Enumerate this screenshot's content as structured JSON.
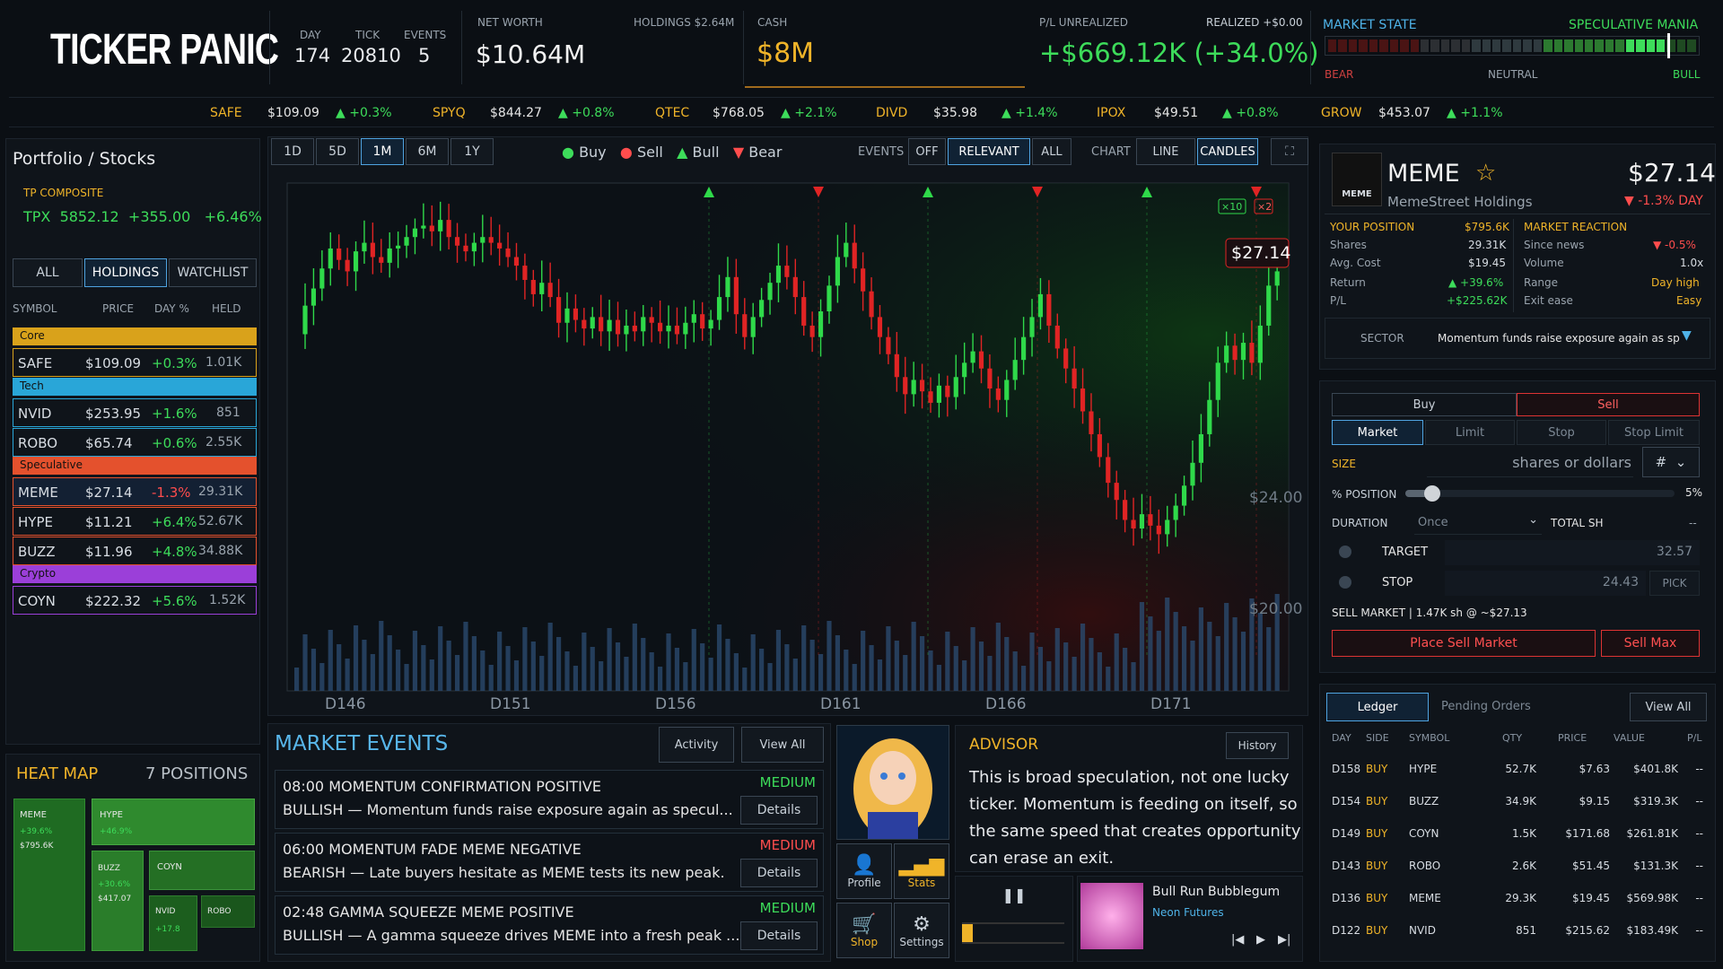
{
  "logo": "TICKER PANIC",
  "header": {
    "day_label": "DAY",
    "day": "174",
    "tick_label": "TICK",
    "tick": "20810",
    "events_label": "EVENTS",
    "events": "5",
    "networth_label": "NET WORTH",
    "networth": "$10.64M",
    "holdings_label": "HOLDINGS $2.64M",
    "cash_label": "CASH",
    "cash": "$8M",
    "pl_label": "P/L UNREALIZED",
    "pl": "+$669.12K (+34.0%)",
    "realized_label": "REALIZED +$0.00",
    "market_state_label": "MARKET STATE",
    "market_state": "SPECULATIVE MANIA",
    "bear": "BEAR",
    "neutral": "NEUTRAL",
    "bull": "BULL",
    "market_level": 0.93
  },
  "ticker_strip": [
    {
      "sym": "SAFE",
      "price": "$109.09",
      "chg": "▲ +0.3%"
    },
    {
      "sym": "SPYQ",
      "price": "$844.27",
      "chg": "▲ +0.8%"
    },
    {
      "sym": "QTEC",
      "price": "$768.05",
      "chg": "▲ +2.1%"
    },
    {
      "sym": "DIVD",
      "price": "$35.98",
      "chg": "▲ +1.4%"
    },
    {
      "sym": "IPOX",
      "price": "$49.51",
      "chg": "▲ +0.8%"
    },
    {
      "sym": "GROW",
      "price": "$453.07",
      "chg": "▲ +1.1%"
    }
  ],
  "portfolio": {
    "title": "Portfolio / Stocks",
    "index_label": "TP COMPOSITE",
    "index_sym": "TPX",
    "index_val": "5852.12",
    "index_chg": "+355.00",
    "index_pct": "+6.46%",
    "tabs": [
      "ALL",
      "HOLDINGS",
      "WATCHLIST"
    ],
    "cols": [
      "SYMBOL",
      "PRICE",
      "DAY %",
      "HELD"
    ],
    "sections": {
      "core": "Core",
      "tech": "Tech",
      "spec": "Speculative",
      "crypto": "Crypto"
    },
    "rows": [
      {
        "sym": "SAFE",
        "price": "$109.09",
        "chg": "+0.3%",
        "held": "1.01K"
      },
      {
        "sym": "NVID",
        "price": "$253.95",
        "chg": "+1.6%",
        "held": "851"
      },
      {
        "sym": "ROBO",
        "price": "$65.74",
        "chg": "+0.6%",
        "held": "2.55K"
      },
      {
        "sym": "MEME",
        "price": "$27.14",
        "chg": "-1.3%",
        "held": "29.31K"
      },
      {
        "sym": "HYPE",
        "price": "$11.21",
        "chg": "+6.4%",
        "held": "52.67K"
      },
      {
        "sym": "BUZZ",
        "price": "$11.96",
        "chg": "+4.8%",
        "held": "34.88K"
      },
      {
        "sym": "COYN",
        "price": "$222.32",
        "chg": "+5.6%",
        "held": "1.52K"
      }
    ]
  },
  "heatmap": {
    "title": "HEAT MAP",
    "positions": "7 POSITIONS",
    "meme": {
      "sym": "MEME",
      "pct": "+39.6%",
      "val": "$795.6K"
    },
    "hype": {
      "sym": "HYPE",
      "pct": "+46.9%"
    },
    "buzz": {
      "sym": "BUZZ",
      "pct": "+30.6%",
      "val": "$417.07"
    },
    "coyn": {
      "sym": "COYN"
    },
    "nvid": {
      "sym": "NVID",
      "pct": "+17.8"
    },
    "robo": {
      "sym": "ROBO"
    }
  },
  "chart_toolbar": {
    "ranges": [
      "1D",
      "5D",
      "1M",
      "6M",
      "1Y"
    ],
    "legend": {
      "buy": "Buy",
      "sell": "Sell",
      "bull": "Bull",
      "bear": "Bear"
    },
    "events_label": "EVENTS",
    "events_opts": [
      "OFF",
      "RELEVANT",
      "ALL"
    ],
    "chart_label": "CHART",
    "chart_opts": [
      "LINE",
      "CANDLES"
    ],
    "expand": "⛶"
  },
  "chart_data": {
    "type": "candlestick",
    "x_ticks": [
      "D146",
      "D151",
      "D156",
      "D161",
      "D166",
      "D171"
    ],
    "price_labels": [
      "$24.00",
      "$20.00"
    ],
    "current_price": "$27.14",
    "badges": [
      "×10",
      "×2"
    ],
    "event_markers": [
      "bull",
      "bear",
      "bull",
      "bear",
      "bull",
      "bear",
      "bull",
      "bear"
    ],
    "ylim": [
      16.5,
      29.5
    ],
    "closes": [
      24.9,
      25.9,
      26.5,
      27.2,
      27.9,
      27.5,
      27.1,
      27.8,
      28.1,
      27.6,
      27.4,
      27.9,
      28.0,
      28.3,
      28.6,
      28.7,
      28.5,
      28.9,
      28.3,
      28.0,
      27.8,
      28.1,
      28.3,
      28.1,
      27.9,
      27.6,
      27.3,
      26.8,
      26.3,
      26.7,
      26.2,
      25.3,
      25.8,
      25.4,
      25.1,
      25.5,
      25.0,
      25.4,
      24.9,
      25.2,
      25.0,
      25.5,
      25.3,
      25.0,
      25.2,
      24.9,
      25.3,
      25.6,
      25.1,
      25.4,
      26.2,
      26.9,
      25.6,
      24.8,
      25.5,
      26.1,
      26.7,
      27.3,
      26.9,
      26.2,
      25.2,
      24.8,
      25.7,
      26.6,
      27.6,
      28.1,
      27.2,
      26.4,
      25.5,
      24.8,
      24.2,
      23.4,
      22.8,
      23.3,
      22.9,
      22.5,
      23.1,
      22.7,
      23.4,
      23.9,
      24.3,
      23.7,
      23.0,
      22.6,
      23.3,
      24.0,
      24.8,
      25.5,
      26.3,
      25.2,
      24.4,
      23.7,
      23.0,
      22.2,
      21.4,
      20.6,
      19.7,
      19.1,
      18.4,
      18.1,
      18.6,
      18.2,
      17.9,
      18.4,
      18.9,
      19.6,
      20.4,
      21.4,
      22.6,
      23.9,
      24.5,
      24.0,
      24.6,
      23.9,
      25.2,
      26.6,
      27.1
    ]
  },
  "events_panel": {
    "title": "MARKET EVENTS",
    "activity": "Activity",
    "view_all": "View All",
    "details": "Details",
    "items": [
      {
        "head": "08:00  MOMENTUM CONFIRMATION  POSITIVE",
        "body": "BULLISH — Momentum funds raise exposure again as specul...",
        "sev": "MEDIUM"
      },
      {
        "head": "06:00  MOMENTUM FADE  MEME  NEGATIVE",
        "body": "BEARISH — Late buyers hesitate as MEME tests its new peak.",
        "sev": "MEDIUM"
      },
      {
        "head": "02:48  GAMMA SQUEEZE  MEME  POSITIVE",
        "body": "BULLISH — A gamma squeeze drives MEME into a fresh peak ...",
        "sev": "MEDIUM"
      }
    ]
  },
  "nav": {
    "profile": "Profile",
    "stats": "Stats",
    "shop": "Shop",
    "settings": "Settings"
  },
  "advisor": {
    "title": "ADVISOR",
    "history": "History",
    "text": "This is broad speculation, not one lucky ticker. Momentum is feeding on itself, so the same speed that creates opportunity can erase an exit."
  },
  "music": {
    "track": "Bull Run Bubblegum",
    "artist": "Neon Futures"
  },
  "stock": {
    "sym": "MEME",
    "name": "MemeStreet Holdings",
    "price": "$27.14",
    "day": "▼ -1.3% DAY",
    "logo_text": "MEME",
    "pos_label": "YOUR POSITION",
    "pos_val": "$795.6K",
    "pos": [
      [
        "Shares",
        "29.31K"
      ],
      [
        "Avg. Cost",
        "$19.45"
      ],
      [
        "Return",
        "▲ +39.6%"
      ],
      [
        "P/L",
        "+$225.62K"
      ]
    ],
    "react_label": "MARKET REACTION",
    "react": [
      [
        "Since news",
        "▼ -0.5%"
      ],
      [
        "Volume",
        "1.0x"
      ],
      [
        "Range",
        "Day high"
      ],
      [
        "Exit ease",
        "Easy"
      ]
    ],
    "sector_label": "SECTOR",
    "sector_text": "Momentum funds raise exposure again as sp"
  },
  "order": {
    "buy": "Buy",
    "sell": "Sell",
    "types": [
      "Market",
      "Limit",
      "Stop",
      "Stop Limit"
    ],
    "size_label": "SIZE",
    "size_placeholder": "shares or dollars",
    "size_unit": "#",
    "pos_label": "% POSITION",
    "pos_pct": "5%",
    "pos_level": 0.05,
    "duration_label": "DURATION",
    "duration": "Once",
    "total_label": "TOTAL SH",
    "total_val": "--",
    "target_label": "TARGET",
    "target_val": "32.57",
    "stop_label": "STOP",
    "stop_val": "24.43",
    "pick": "PICK",
    "summary": "SELL MARKET | 1.47K sh @ ~$27.13",
    "place": "Place Sell Market",
    "max": "Sell Max"
  },
  "ledger": {
    "tabs": [
      "Ledger",
      "Pending Orders"
    ],
    "view_all": "View All",
    "cols": [
      "DAY",
      "SIDE",
      "SYMBOL",
      "QTY",
      "PRICE",
      "VALUE",
      "P/L"
    ],
    "rows": [
      [
        "D158",
        "BUY",
        "HYPE",
        "52.7K",
        "$7.63",
        "$401.8K",
        "--"
      ],
      [
        "D154",
        "BUY",
        "BUZZ",
        "34.9K",
        "$9.15",
        "$319.3K",
        "--"
      ],
      [
        "D149",
        "BUY",
        "COYN",
        "1.5K",
        "$171.68",
        "$261.81K",
        "--"
      ],
      [
        "D143",
        "BUY",
        "ROBO",
        "2.6K",
        "$51.45",
        "$131.3K",
        "--"
      ],
      [
        "D136",
        "BUY",
        "MEME",
        "29.3K",
        "$19.45",
        "$569.98K",
        "--"
      ],
      [
        "D122",
        "BUY",
        "NVID",
        "851",
        "$215.62",
        "$183.49K",
        "--"
      ]
    ]
  }
}
